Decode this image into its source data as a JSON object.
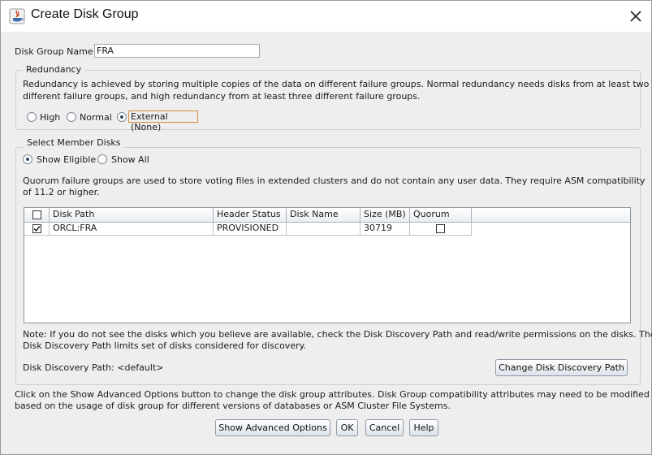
{
  "window": {
    "title": "Create Disk Group"
  },
  "disk_group_name": {
    "label": "Disk Group Name",
    "value": "FRA"
  },
  "redundancy": {
    "legend": "Redundancy",
    "description_line1": "Redundancy is achieved by storing multiple copies of the data on different failure groups. Normal redundancy needs disks from at least two",
    "description_line2": "different failure groups, and high redundancy from at least three different failure groups.",
    "options": [
      "High",
      "Normal",
      "External (None)"
    ],
    "selected": "External (None)"
  },
  "member_disks": {
    "legend": "Select Member Disks",
    "filter_options": [
      "Show Eligible",
      "Show All"
    ],
    "selected_filter": "Show Eligible",
    "quorum_note_line1": "Quorum failure groups are used to store voting files in extended clusters and do not contain any user data. They require ASM compatibility",
    "quorum_note_line2": "of 11.2 or higher.",
    "table": {
      "columns": [
        "Disk Path",
        "Header Status",
        "Disk Name",
        "Size (MB)",
        "Quorum"
      ],
      "rows": [
        {
          "selected": true,
          "disk_path": "ORCL:FRA",
          "header_status": "PROVISIONED",
          "disk_name": "",
          "size_mb": "30719",
          "quorum": false
        }
      ]
    },
    "note_line1": "Note: If you do not see the disks which you believe are available, check the Disk Discovery Path and read/write permissions on the disks. The",
    "note_line2": "Disk Discovery Path limits set of disks considered for discovery.",
    "discovery_path_label": "Disk Discovery Path: <default>",
    "change_path_button": "Change Disk Discovery Path"
  },
  "footer": {
    "info_line1": "Click on the Show Advanced Options button to change the disk group attributes. Disk Group compatibility attributes may need to be modified",
    "info_line2": "based on the usage of disk group for different versions of databases or ASM Cluster File Systems.",
    "buttons": {
      "advanced": "Show Advanced Options",
      "ok": "OK",
      "cancel": "Cancel",
      "help": "Help"
    }
  },
  "colors": {
    "background": "#eeeeee",
    "focus_outline": "#d38b3a",
    "title_bar": "#ffffff"
  }
}
